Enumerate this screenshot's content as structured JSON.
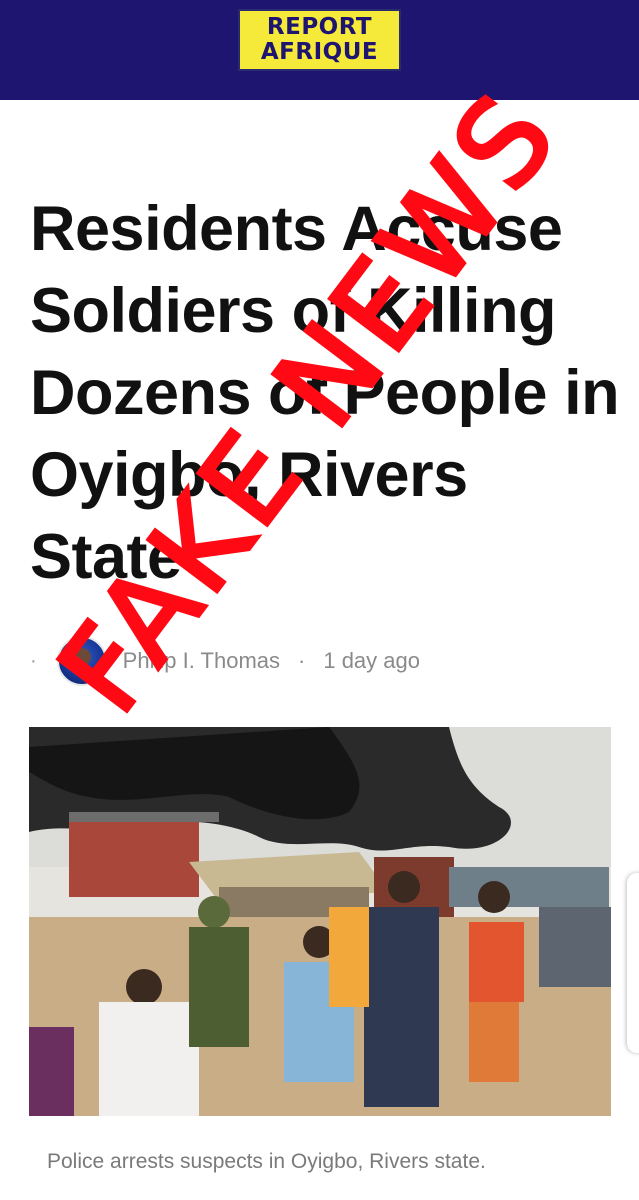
{
  "header": {
    "logo_line1": "REPORT",
    "logo_line2": "AFRIQUE",
    "bar_color": "#1d1570",
    "logo_color": "#f5e93a"
  },
  "article": {
    "title": "Residents Accuse Soldiers of Killing Dozens of People in Oyigbo, Rivers State",
    "meta_dot": "·",
    "author": "Philip I. Thomas",
    "separator": "·",
    "time": "1 day ago",
    "image_icon": "news-photo",
    "caption": "Police arrests suspects in Oyigbo, Rivers state."
  },
  "overlay": {
    "stamp_text": "FAKE NEWS",
    "stamp_color": "#ff0a14"
  }
}
